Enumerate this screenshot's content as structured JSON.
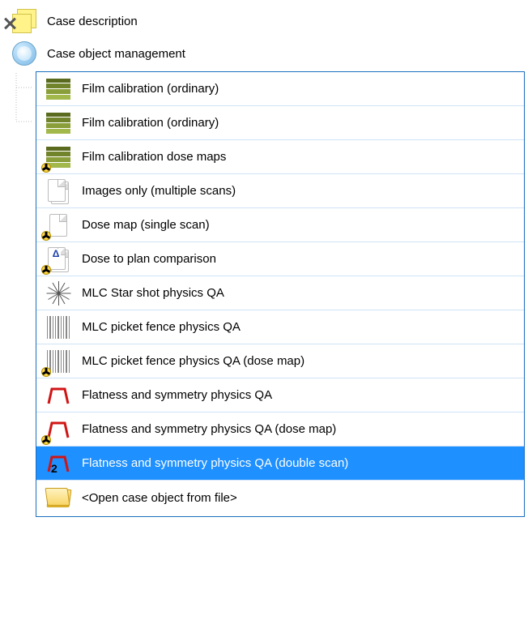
{
  "root": {
    "case_description_label": "Case description",
    "case_object_mgmt_label": "Case object management"
  },
  "items": [
    {
      "label": "Film calibration (ordinary)",
      "icon": "film",
      "rad": false,
      "selected": false
    },
    {
      "label": "Film calibration (ordinary)",
      "icon": "film",
      "rad": false,
      "selected": false
    },
    {
      "label": "Film calibration dose maps",
      "icon": "film",
      "rad": true,
      "selected": false
    },
    {
      "label": "Images only (multiple scans)",
      "icon": "doc-stack",
      "rad": false,
      "selected": false
    },
    {
      "label": "Dose map (single scan)",
      "icon": "doc",
      "rad": true,
      "selected": false
    },
    {
      "label": "Dose to plan comparison",
      "icon": "doc-stack-delta",
      "rad": true,
      "selected": false
    },
    {
      "label": "MLC Star shot physics QA",
      "icon": "starshot",
      "rad": false,
      "selected": false
    },
    {
      "label": "MLC picket fence physics QA",
      "icon": "fence",
      "rad": false,
      "selected": false
    },
    {
      "label": "MLC picket fence physics QA (dose map)",
      "icon": "fence",
      "rad": true,
      "selected": false
    },
    {
      "label": "Flatness and symmetry physics QA",
      "icon": "flatsym",
      "rad": false,
      "selected": false
    },
    {
      "label": "Flatness and symmetry physics QA (dose map)",
      "icon": "flatsym",
      "rad": true,
      "selected": false
    },
    {
      "label": "Flatness and symmetry physics QA (double scan)",
      "icon": "flatsym2",
      "rad": false,
      "selected": true
    },
    {
      "label": "<Open case object from file>",
      "icon": "folder",
      "rad": false,
      "selected": false
    }
  ]
}
